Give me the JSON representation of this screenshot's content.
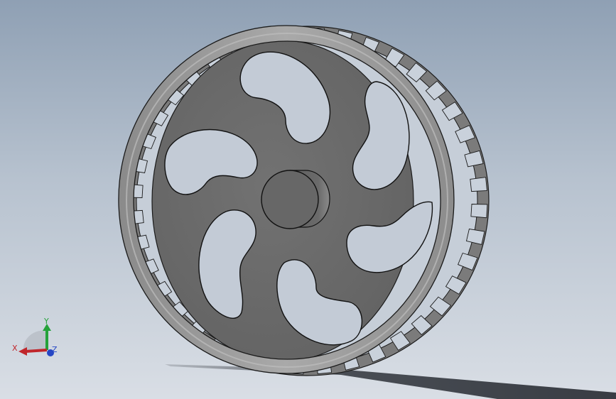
{
  "viewport": {
    "model_name": "",
    "view_mode": "shaded-with-edges"
  },
  "triad": {
    "x_label": "X",
    "y_label": "Y",
    "z_label": "Z",
    "x_color": "#c0262b",
    "y_color": "#25a23a",
    "z_color": "#2546c4"
  },
  "model": {
    "type": "wheel-with-five-curved-spokes",
    "spoke_count": 5,
    "rim_slot_rows": "rectangular-openings",
    "colors": {
      "face": "#6c6c6c",
      "rim": "#9d9d9d",
      "rim_shade": "#7a7a7a",
      "edge": "#1a1a1a",
      "hub": "#636363",
      "shadow": "#3a3f48"
    }
  }
}
